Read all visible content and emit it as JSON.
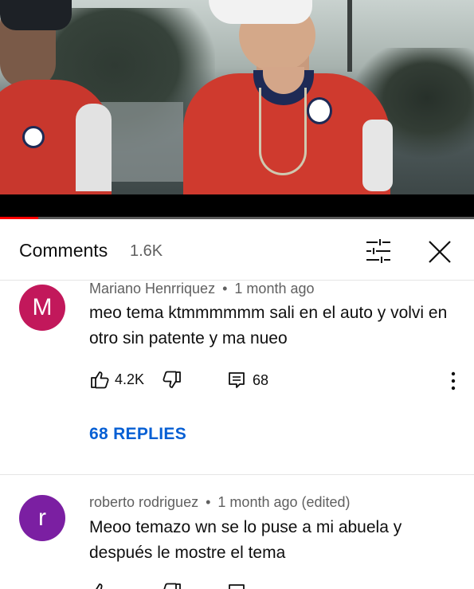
{
  "video": {
    "progress": 0.08
  },
  "comments_panel": {
    "title": "Comments",
    "count": "1.6K",
    "filter_icon": "sort-filter-icon",
    "close_icon": "close-icon"
  },
  "comments": [
    {
      "avatar_letter": "M",
      "avatar_color": "#c2185b",
      "author": "Mariano Henrriquez",
      "time": "1 month ago",
      "text": "meo tema ktmmmmmm sali en el auto y volvi en otro sin patente y ma nueo",
      "likes": "4.2K",
      "reply_count": "68",
      "replies_label": "68 REPLIES"
    },
    {
      "avatar_letter": "r",
      "avatar_color": "#7b1fa2",
      "author": "roberto rodriguez",
      "time": "1 month ago (edited)",
      "text": "Meoo temazo wn se lo puse a mi abuela y después le mostre el tema"
    }
  ],
  "separator": "•",
  "icons": {
    "like": "thumb-up-icon",
    "dislike": "thumb-down-icon",
    "reply": "reply-comment-icon",
    "more": "more-vert-icon"
  },
  "colors": {
    "link_blue": "#065fd4",
    "progress_red": "#ff0000"
  }
}
